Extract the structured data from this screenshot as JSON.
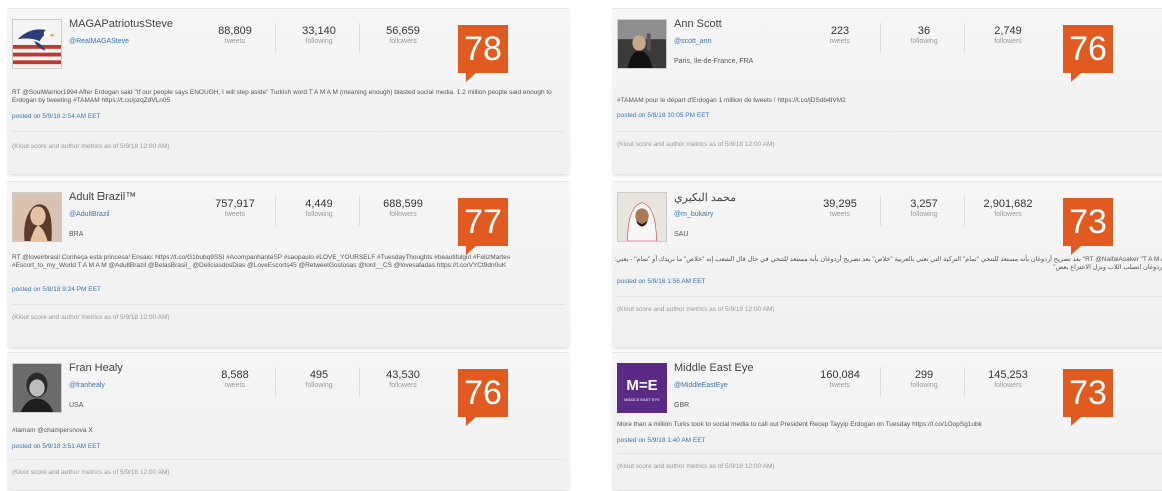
{
  "cards": [
    {
      "name": "MAGAPatriotusSteve",
      "handle": "@RealMAGASteve",
      "location": "",
      "tweets": "88,809",
      "following": "33,140",
      "followers": "56,659",
      "score": "78",
      "tweet": "RT @SoulWarrior1994 After Erdogan said \"If our people says ENOUGH, I will step aside\" Turkish word T A M A M (meaning enough) blasted social media. 1.2 million people said enough to Erdogan by tweeting #TAMAM https://t.co/pzqZdVLn05",
      "posted": "posted on 5/9/18 2:54 AM EET",
      "footer": "(Klout score and author metrics as of 5/9/18 12:00 AM)"
    },
    {
      "name": "Adult ᗷrazil™",
      "handle": "@AdultBrazil",
      "location": "BRA",
      "tweets": "757,917",
      "following": "4,449",
      "followers": "688,599",
      "score": "77",
      "tweet": "RT @loveirbrasil Conheça esta princesa! Ensaio: https://t.co/G1bubq9SSI #AcompanhanteSP #saopaulo #LOVE_YOURSELF #TuesdayThoughts #beautifulgirl #FelizMartes #Escort_to_my_World T A M A M @AdultBrazil @BelasBrasil_ @DeliciasdosDias @LoveEscorts45 @RetweetGostosas @lord__CS @lovesafadas https://t.co/VYCt9dn0uK",
      "posted": "posted on 5/8/18 9:24 PM EET",
      "footer": "(Klout score and author metrics as of 5/9/18 12:00 AM)"
    },
    {
      "name": "Fran Healy",
      "handle": "@franhealy",
      "location": "USA",
      "tweets": "8,588",
      "following": "495",
      "followers": "43,530",
      "score": "76",
      "tweet": "#tamam @champersnova X",
      "posted": "posted on 5/9/18 3:51 AM EET",
      "footer": "(Klout score and author metrics as of 5/9/18 12:00 AM)"
    },
    {
      "name": "Ann Scott",
      "handle": "@scott_ann",
      "location": "Paris, Ile-de-France, FRA",
      "tweets": "223",
      "following": "36",
      "followers": "2,749",
      "score": "76",
      "tweet": "#TAMAM pour le départ d'Erdogan 1 million de tweets ! https://t.co/jDSdb4IVM2",
      "posted": "posted on 5/8/18 10:05 PM EET",
      "footer": "(Klout score and author metrics as of 5/8/18 12:00 AM)"
    },
    {
      "name": "محمد البكيري",
      "handle": "@m_bukairy",
      "location": "SAU",
      "tweets": "39,295",
      "following": "3,257",
      "followers": "2,901,682",
      "score": "73",
      "tweet": "RT @NaifalAsaker \"T A M A M\" بعد تصريح أردوغان بأنه مستعد للتنحي \"تمام\" التركية التي تعني بالعربية \"خلاص\" بعد تصريح أردوغان بأنه مستعد للتنحي في حال قال الشعب إنه \"خلاص\" ما نريدك أو \"تمام\" - يعني: \"يا أردوغان اتصلب اللاب ونزل الاعتزاع بعض\"",
      "posted": "posted on 5/9/18 1:56 AM EET",
      "footer": "(Klout score and author metrics as of 5/9/18 12:00 AM)"
    },
    {
      "name": "Middle East Eye",
      "handle": "@MiddleEastEye",
      "location": "GBR",
      "tweets": "160,084",
      "following": "299",
      "followers": "145,253",
      "score": "73",
      "tweet": "More than a million Turks took to social media to call out President Recep Tayyip Erdogan on Tuesday https://t.co/1OopSg1ubk",
      "posted": "posted on 5/9/18 1:40 AM EET",
      "footer": "(Klout score and author metrics as of 5/9/18 12:00 AM)"
    }
  ],
  "labels": {
    "tweets": "tweets",
    "following": "following",
    "followers": "followers"
  },
  "logo_text": {
    "mee": "M=E",
    "mee_sub": "MIDDLE EAST EYE"
  },
  "colors": {
    "score_bg": "#e15a1f",
    "link": "#3b73b9"
  }
}
